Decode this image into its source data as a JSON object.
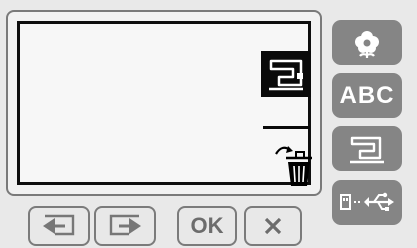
{
  "side_panel": {
    "buttons": [
      {
        "name": "flower-icon"
      },
      {
        "label": "ABC"
      },
      {
        "name": "sewing-machine-icon"
      },
      {
        "name": "usb-memory-icon"
      }
    ]
  },
  "screen": {
    "mode_icon": "sewing-machine-icon",
    "delete_icon": "trash-icon"
  },
  "bottom_bar": {
    "ok_label": "OK"
  },
  "colors": {
    "button_gray": "#858585",
    "lcd_border": "#0e0e0e",
    "background": "#e9e9e9"
  }
}
